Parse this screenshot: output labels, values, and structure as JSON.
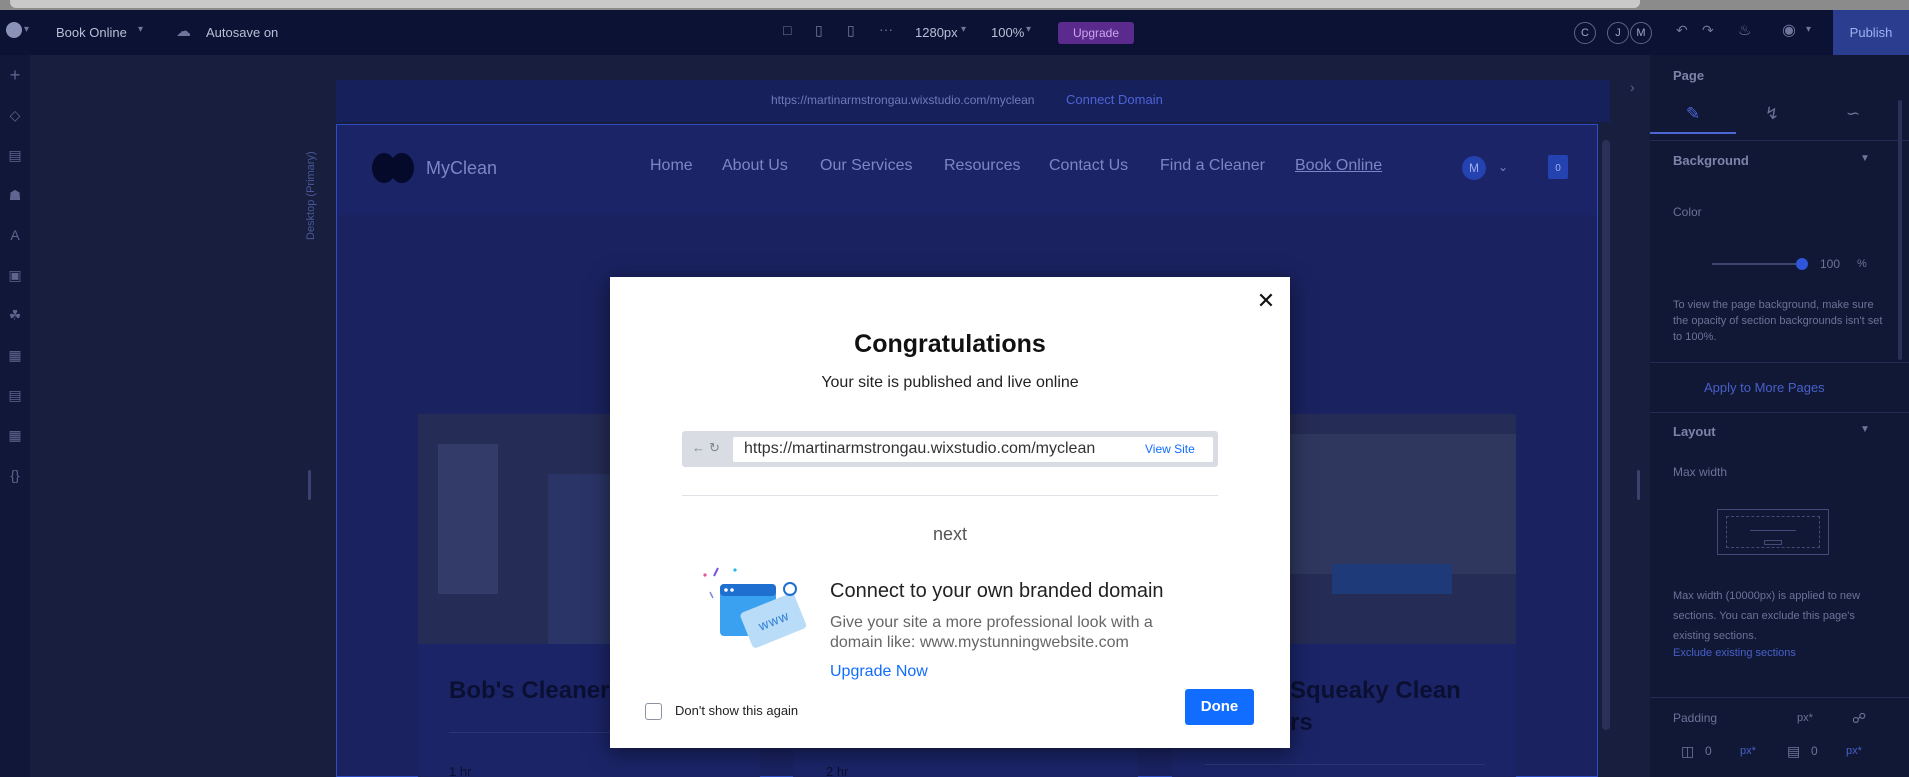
{
  "topbar": {
    "page_name": "Book Online",
    "autosave": "Autosave on",
    "width_value": "1280px",
    "zoom_value": "100%",
    "upgrade_label": "Upgrade",
    "collaborators": [
      "C",
      "J",
      "M"
    ],
    "publish_label": "Publish"
  },
  "canvas": {
    "site_url": "https://martinarmstrongau.wixstudio.com/myclean",
    "connect_domain": "Connect Domain",
    "breakpoint_label": "Desktop (Primary)"
  },
  "site": {
    "brand": "MyClean",
    "nav": [
      "Home",
      "About Us",
      "Our Services",
      "Resources",
      "Contact Us",
      "Find a Cleaner",
      "Book Online"
    ],
    "user_initial": "M",
    "cart_count": "0",
    "cards": [
      {
        "title": "Bob's Cleaners",
        "duration": "1 hr"
      },
      {
        "title": "",
        "duration": "2 hr"
      },
      {
        "title": "Squeaky Clean",
        "title_line2": "rs",
        "duration": ""
      }
    ]
  },
  "right_panel": {
    "title": "Page",
    "background_section": "Background",
    "color_label": "Color",
    "opacity_value": "100",
    "opacity_unit": "%",
    "background_note": "To view the page background, make sure the opacity of section backgrounds isn't set to 100%.",
    "apply_more": "Apply to More Pages",
    "layout_section": "Layout",
    "max_width_label": "Max width",
    "max_width_note": "Max width (10000px) is applied to new sections. You can exclude this page's existing sections.",
    "exclude_link": "Exclude existing sections",
    "padding_label": "Padding",
    "padding_unit": "px*",
    "padding_left": "0",
    "padding_top": "0"
  },
  "modal": {
    "title": "Congratulations",
    "subtitle": "Your site is published and live online",
    "url": "https://martinarmstrongau.wixstudio.com/myclean",
    "view_site": "View Site",
    "next_label": "next",
    "heading": "Connect to your own branded domain",
    "description": "Give your site a more professional look with a domain like: www.mystunningwebsite.com",
    "upgrade_link": "Upgrade Now",
    "dont_show": "Don't show this again",
    "done_label": "Done",
    "illustration_text": "www"
  },
  "colors": {
    "accent": "#116dff",
    "topbar_bg": "#0b1234",
    "overlay_canvas": "#1a2260"
  }
}
